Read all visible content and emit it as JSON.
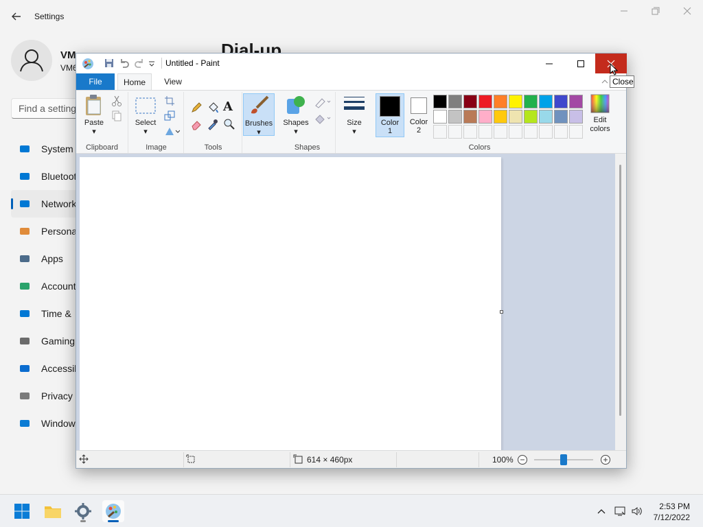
{
  "settings": {
    "title": "Settings",
    "profile_name": "VM",
    "profile_sub": "VM6",
    "page_title": "Dial-up",
    "search_placeholder": "Find a setting",
    "nav": [
      {
        "label": "System",
        "icon": "monitor-icon",
        "color": "#0078d4"
      },
      {
        "label": "Bluetoot",
        "icon": "bluetooth-icon",
        "color": "#0078d4"
      },
      {
        "label": "Network",
        "icon": "wifi-icon",
        "color": "#0078d4",
        "active": true
      },
      {
        "label": "Persona",
        "icon": "brush-icon",
        "color": "#e08b3a"
      },
      {
        "label": "Apps",
        "icon": "apps-icon",
        "color": "#4c6b8a"
      },
      {
        "label": "Account",
        "icon": "person-icon",
        "color": "#2aa36b"
      },
      {
        "label": "Time &",
        "icon": "clock-globe-icon",
        "color": "#0078d4"
      },
      {
        "label": "Gaming",
        "icon": "gamepad-icon",
        "color": "#6b6b6b"
      },
      {
        "label": "Accessib",
        "icon": "accessibility-icon",
        "color": "#0a6ccf"
      },
      {
        "label": "Privacy",
        "icon": "shield-icon",
        "color": "#7a7a7a"
      },
      {
        "label": "Window",
        "icon": "windows-update-icon",
        "color": "#0a7bd4"
      }
    ]
  },
  "paint": {
    "title": "Untitled - Paint",
    "tooltip": "Close",
    "tabs": {
      "file": "File",
      "home": "Home",
      "view": "View"
    },
    "groups": {
      "clipboard": "Clipboard",
      "image": "Image",
      "tools": "Tools",
      "shapes": "Shapes",
      "colors": "Colors"
    },
    "buttons": {
      "paste": "Paste",
      "select": "Select",
      "brushes": "Brushes",
      "shapes": "Shapes",
      "size": "Size",
      "color1": "Color 1",
      "color1_a": "Color",
      "color1_b": "1",
      "color2_a": "Color",
      "color2_b": "2",
      "edit_colors_a": "Edit",
      "edit_colors_b": "colors"
    },
    "color1_value": "#000000",
    "color2_value": "#ffffff",
    "palette": [
      "#000000",
      "#7f7f7f",
      "#880015",
      "#ed1c24",
      "#ff7f27",
      "#fff200",
      "#22b14c",
      "#00a2e8",
      "#3f48cc",
      "#a349a4",
      "#ffffff",
      "#c3c3c3",
      "#b97a57",
      "#ffaec9",
      "#ffc90e",
      "#efe4b0",
      "#b5e61d",
      "#99d9ea",
      "#7092be",
      "#c8bfe7"
    ],
    "status": {
      "canvas_size": "614 × 460px",
      "zoom": "100%"
    }
  },
  "taskbar": {
    "time": "2:53 PM",
    "date": "7/12/2022",
    "apps": [
      "start-icon",
      "file-explorer-icon",
      "settings-icon",
      "paint-icon"
    ]
  }
}
